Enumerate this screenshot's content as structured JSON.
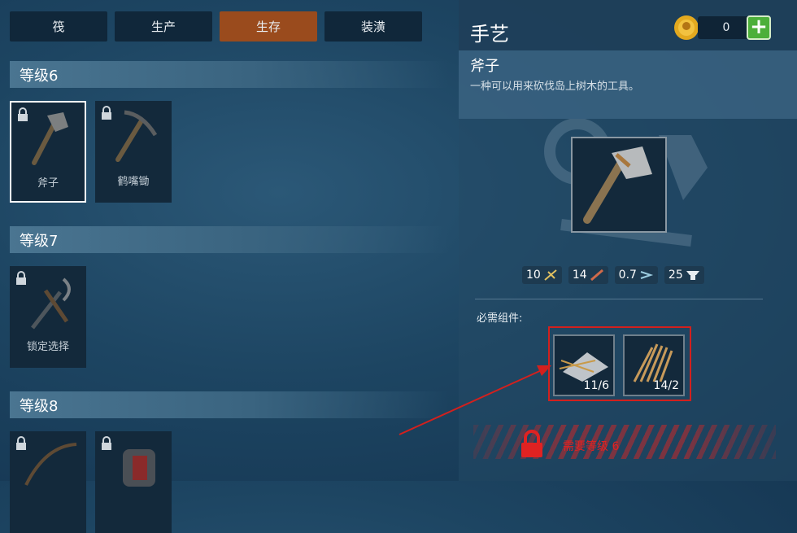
{
  "tabs": [
    {
      "label": "筏",
      "active": false
    },
    {
      "label": "生产",
      "active": false
    },
    {
      "label": "生存",
      "active": true
    },
    {
      "label": "装潢",
      "active": false
    }
  ],
  "levels": [
    {
      "label": "等级6",
      "items": [
        {
          "label": "斧子",
          "selected": true,
          "locked": true
        },
        {
          "label": "鹤嘴锄",
          "selected": false,
          "locked": true
        }
      ]
    },
    {
      "label": "等级7",
      "items": [
        {
          "label": "锁定选择",
          "selected": false,
          "locked": true
        }
      ]
    },
    {
      "label": "等级8",
      "items": [
        {
          "label": "",
          "locked": true
        },
        {
          "label": "",
          "locked": true
        }
      ]
    }
  ],
  "panel": {
    "title": "手艺",
    "coins": "0",
    "item_name": "斧子",
    "item_desc": "一种可以用来砍伐岛上树木的工具。",
    "stats": [
      {
        "value": "10",
        "icon": "durability-icon"
      },
      {
        "value": "14",
        "icon": "damage-icon"
      },
      {
        "value": "0.7",
        "icon": "speed-icon"
      },
      {
        "value": "25",
        "icon": "anvil-icon"
      }
    ],
    "required_label": "必需组件:",
    "requirements": [
      {
        "icon": "scrap-bundle-icon",
        "count": "11/6"
      },
      {
        "icon": "straw-bundle-icon",
        "count": "14/2"
      }
    ],
    "warning": "需要等级 6"
  },
  "colors": {
    "active_tab": "#9a4b1d",
    "highlight": "#d3201d",
    "plus": "#4caf3a"
  }
}
